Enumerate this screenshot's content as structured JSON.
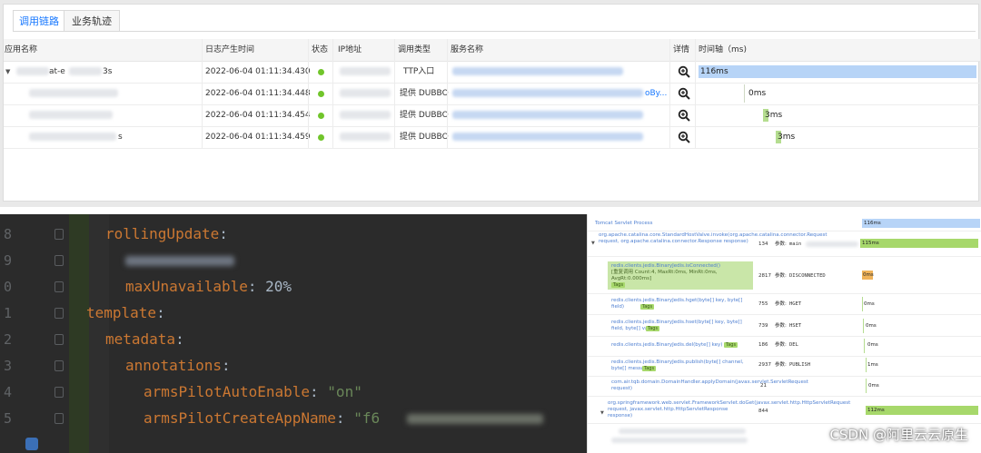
{
  "tabs": [
    "调用链路",
    "业务轨迹"
  ],
  "columns": {
    "app": "应用名称",
    "time": "日志产生时间",
    "status": "状态",
    "ip": "IP地址",
    "type": "调用类型",
    "service": "服务名称",
    "detail": "详情",
    "timeline": "时间轴（ms)"
  },
  "rows": [
    {
      "app_prefix": "",
      "app_mid": "at-e",
      "app_suffix": "3s",
      "time": "2022-06-04 01:11:34.430",
      "type": "TTP入口",
      "service_tail": "",
      "timeline_label": "116ms",
      "timeline_pct": 100
    },
    {
      "app_prefix": "",
      "app_mid": "",
      "app_suffix": "",
      "time": "2022-06-04 01:11:34.448",
      "type": "提供 DUBBO",
      "service_tail": "oBy...",
      "timeline_label": "0ms",
      "timeline_pct": 0
    },
    {
      "app_prefix": "",
      "app_mid": "",
      "app_suffix": "",
      "time": "2022-06-04 01:11:34.454",
      "type": "提供 DUBBO",
      "service_tail": "",
      "timeline_label": "3ms",
      "timeline_pct": 3
    },
    {
      "app_prefix": "",
      "app_mid": "",
      "app_suffix": "s",
      "time": "2022-06-04 01:11:34.459",
      "type": "提供 DUBBO",
      "service_tail": "",
      "timeline_label": "3ms",
      "timeline_pct": 3
    }
  ],
  "code": {
    "line_numbers": [
      "8",
      "9",
      "0",
      "1",
      "2",
      "3",
      "4",
      "5"
    ],
    "lines": [
      {
        "key": "rollingUpdate",
        "punc": ":",
        "value": ""
      },
      {
        "key": "",
        "punc": "",
        "value": ""
      },
      {
        "key": "maxUnavailable",
        "punc": ": ",
        "value": "20%"
      },
      {
        "key": "template",
        "punc": ":",
        "value": ""
      },
      {
        "key": "metadata",
        "punc": ":",
        "value": ""
      },
      {
        "key": "annotations",
        "punc": ":",
        "value": ""
      },
      {
        "key": "armsPilotAutoEnable",
        "punc": ": ",
        "value": "\"on\""
      },
      {
        "key": "armsPilotCreateAppName",
        "punc": ": ",
        "value": "\"f6"
      }
    ]
  },
  "spans": {
    "root": {
      "title": "Tomcat Servlet Process",
      "duration": "116ms"
    },
    "items": [
      {
        "method": "org.apache.catalina.core.StandardHostValve.invoke(org.apache.catalina.connector.Request request, org.apache.catalina.connector.Response response)",
        "cost": "134",
        "param_label": "参数:",
        "param": "main",
        "tag": "",
        "extra": "",
        "duration": "115ms"
      },
      {
        "method": "redis.clients.jedis.BinaryJedis.isConnected()",
        "extra": "[重复调用 Count:4, MaxRt:0ms, MinRt:0ms, AvgRt:0.000ms]",
        "tag": "Tags",
        "cost": "2817",
        "param_label": "参数:",
        "param": "DISCONNECTED",
        "duration": "0ms"
      },
      {
        "method": "redis.clients.jedis.BinaryJedis.hget(byte[] key, byte[] field)",
        "tag": "Tags",
        "cost": "755",
        "param_label": "参数:",
        "param": "HGET",
        "extra": "",
        "duration": "0ms"
      },
      {
        "method": "redis.clients.jedis.BinaryJedis.hset(byte[] key, byte[] field, byte[] value)",
        "tag": "Tags",
        "cost": "739",
        "param_label": "参数:",
        "param": "HSET",
        "extra": "",
        "duration": "0ms"
      },
      {
        "method": "redis.clients.jedis.BinaryJedis.del(byte[] key)",
        "tag": "Tags",
        "cost": "186",
        "param_label": "参数:",
        "param": "DEL",
        "extra": "",
        "duration": "0ms"
      },
      {
        "method": "redis.clients.jedis.BinaryJedis.publish(byte[] channel, byte[] message)",
        "tag": "Tags",
        "cost": "2937",
        "param_label": "参数:",
        "param": "PUBLISH",
        "extra": "",
        "duration": "1ms"
      },
      {
        "method": "com.air.tqb.domain.DomainHandler.applyDomain(javax.servlet.ServletRequest request)",
        "tag": "",
        "cost": "21",
        "param_label": "",
        "param": "",
        "extra": "",
        "duration": "0ms"
      },
      {
        "method": "org.springframework.web.servlet.FrameworkServlet.doGet(javax.servlet.http.HttpServletRequest request, javax.servlet.http.HttpServletResponse response)",
        "tag": "",
        "cost": "844",
        "param_label": "",
        "param": "",
        "extra": "",
        "duration": "112ms"
      }
    ]
  },
  "watermark": "CSDN @阿里云云原生",
  "colors": {
    "accent": "#1677ff",
    "timeline_root": "#b7d4f7",
    "timeline_child": "#b5dd90",
    "status_ok": "#71c52b",
    "editor_bg": "#2b2b2b",
    "span_green": "#a7d86b",
    "span_orange": "#f0b35a"
  }
}
